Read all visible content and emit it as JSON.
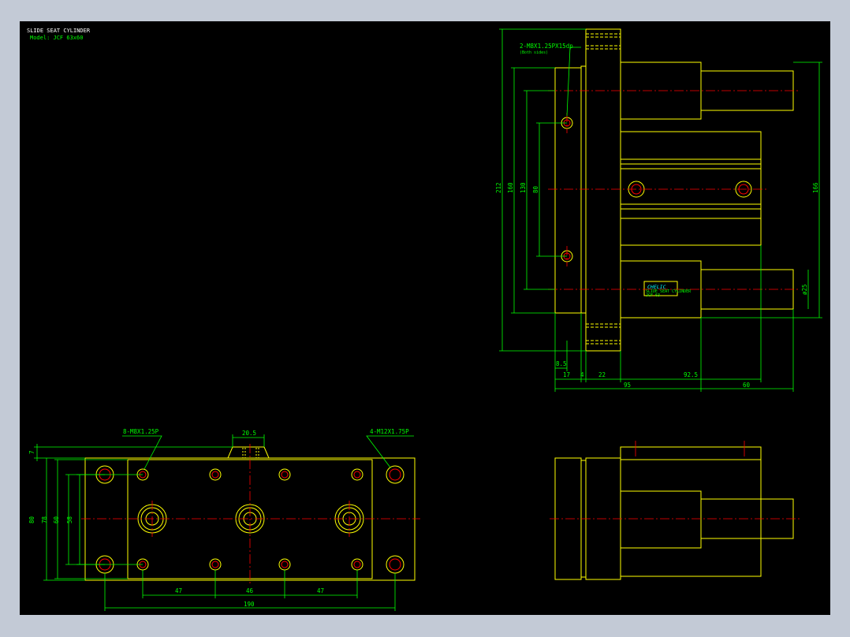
{
  "drawing": {
    "title": "SLIDE SEAT CYLINDER",
    "model": "Model: JCF 63x60",
    "colors": {
      "background": "#000000",
      "outline": "#ffff00",
      "dimension": "#00ff00",
      "centerline": "#ff0000",
      "brand": "#00ffff"
    }
  },
  "side_view": {
    "note_holes": "2-M8X1.25PX15dp",
    "note_sides": "(Both sides)",
    "dim_212": "212",
    "dim_160": "160",
    "dim_130": "130",
    "dim_80": "80",
    "dim_166": "166",
    "dim_phi25": "ø25",
    "dim_8_5": "8.5",
    "dim_17": "17",
    "dim_4": "4",
    "dim_22": "22",
    "dim_92_5": "92.5",
    "dim_95": "95",
    "dim_60": "60",
    "brand": "CHELIC",
    "plate_line1": "SLIDE SEAT CYLINDER",
    "plate_line2": "JCF 63"
  },
  "front_view": {
    "note_left": "8-M8X1.25P",
    "note_right": "4-M12X1.75P",
    "dim_20_5": "20.5",
    "dim_7": "7",
    "dim_80": "80",
    "dim_78": "78",
    "dim_60": "60",
    "dim_58": "58",
    "dim_47a": "47",
    "dim_46": "46",
    "dim_47b": "47",
    "dim_190": "190"
  }
}
